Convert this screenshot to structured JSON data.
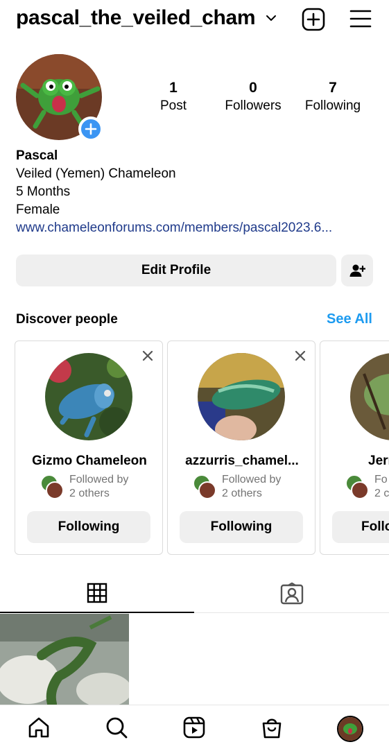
{
  "header": {
    "username": "pascal_the_veiled_cham",
    "icons": [
      "chevron-down-icon",
      "add-post-icon",
      "menu-icon"
    ]
  },
  "profile": {
    "stats": [
      {
        "value": "1",
        "label": "Post"
      },
      {
        "value": "0",
        "label": "Followers"
      },
      {
        "value": "7",
        "label": "Following"
      }
    ],
    "name": "Pascal",
    "bio_lines": [
      "Veiled (Yemen) Chameleon",
      "5 Months",
      "Female"
    ],
    "link": "www.chameleonforums.com/members/pascal2023.6...",
    "edit_label": "Edit Profile"
  },
  "discover": {
    "title": "Discover people",
    "see_all": "See All",
    "cards": [
      {
        "name": "Gizmo Chameleon",
        "followed_line1": "Followed by",
        "followed_line2": "2 others",
        "button": "Following"
      },
      {
        "name": "azzurris_chamel...",
        "followed_line1": "Followed by",
        "followed_line2": "2 others",
        "button": "Following"
      },
      {
        "name": "Jerry",
        "followed_line1": "Fo",
        "followed_line2": "2 c",
        "button": "Follo"
      }
    ]
  },
  "tabs": [
    "grid-icon",
    "tagged-icon"
  ],
  "bottom_nav": [
    "home-icon",
    "search-icon",
    "reels-icon",
    "shop-icon",
    "profile-avatar"
  ],
  "colors": {
    "link": "#1f3a8a",
    "accent_blue": "#1d9bf0",
    "button_bg": "#efefef",
    "plus_badge": "#3b95f3"
  }
}
